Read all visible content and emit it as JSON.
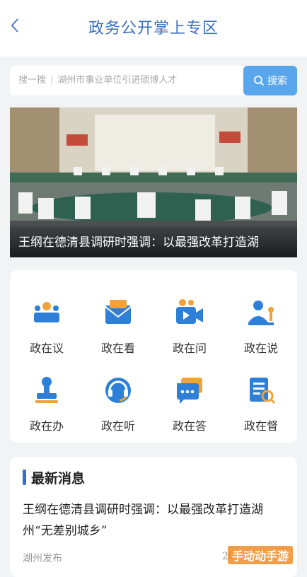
{
  "header": {
    "back_icon": "chevron-left-icon",
    "title": "政务公开掌上专区"
  },
  "search": {
    "label": "搜一搜",
    "placeholder": "湖州市事业单位引进硕博人才",
    "button_label": "搜索",
    "button_color": "#5aa6ec"
  },
  "banner": {
    "caption": "王纲在德清县调研时强调：以最强改革打造湖"
  },
  "services": [
    {
      "label": "政在议",
      "icon": "meeting-icon"
    },
    {
      "label": "政在看",
      "icon": "mail-icon"
    },
    {
      "label": "政在问",
      "icon": "video-icon"
    },
    {
      "label": "政在说",
      "icon": "speaker-icon"
    },
    {
      "label": "政在办",
      "icon": "stamp-icon"
    },
    {
      "label": "政在听",
      "icon": "headset-icon"
    },
    {
      "label": "政在答",
      "icon": "chat-icon"
    },
    {
      "label": "政在督",
      "icon": "inspect-icon"
    }
  ],
  "news": {
    "section_title": "最新消息",
    "item_title": "王纲在德清县调研时强调：以最强改革打造湖州“无差别城乡”",
    "source": "湖州发布",
    "date": "20"
  },
  "watermark": "手动动手游",
  "colors": {
    "accent": "#3a6fc1",
    "icon_blue": "#2d7fd8",
    "icon_orange": "#f2a23a"
  }
}
